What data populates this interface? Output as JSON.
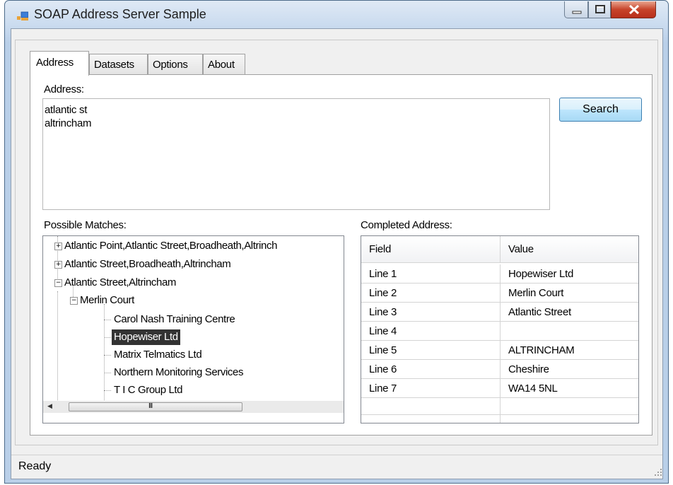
{
  "window": {
    "title": "SOAP Address Server Sample",
    "accent": "#c7432a"
  },
  "tabs": [
    {
      "label": "Address",
      "active": true
    },
    {
      "label": "Datasets",
      "active": false
    },
    {
      "label": "Options",
      "active": false
    },
    {
      "label": "About",
      "active": false
    }
  ],
  "address": {
    "label": "Address:",
    "lines": [
      "atlantic st",
      "altrincham"
    ],
    "search_label": "Search"
  },
  "matches": {
    "label": "Possible Matches:",
    "items": [
      {
        "text": "Atlantic Point,Atlantic Street,Broadheath,Altrinch",
        "expander": "+"
      },
      {
        "text": "Atlantic Street,Broadheath,Altrincham",
        "expander": "+"
      },
      {
        "text": "Atlantic Street,Altrincham",
        "expander": "−"
      },
      {
        "text": "Merlin Court",
        "expander": "−"
      },
      {
        "text": "Carol Nash Training Centre"
      },
      {
        "text": "Hopewiser Ltd",
        "selected": true
      },
      {
        "text": "Matrix Telmatics Ltd"
      },
      {
        "text": "Northern Monitoring Services"
      },
      {
        "text": "T I C Group Ltd"
      }
    ],
    "hscroll_glyph": "III"
  },
  "completed": {
    "label": "Completed Address:",
    "headers": {
      "field": "Field",
      "value": "Value"
    },
    "rows": [
      {
        "field": "Line 1",
        "value": "Hopewiser Ltd"
      },
      {
        "field": "Line 2",
        "value": "Merlin Court"
      },
      {
        "field": "Line 3",
        "value": "Atlantic Street"
      },
      {
        "field": "Line 4",
        "value": ""
      },
      {
        "field": "Line 5",
        "value": "ALTRINCHAM"
      },
      {
        "field": "Line 6",
        "value": "Cheshire"
      },
      {
        "field": "Line 7",
        "value": "WA14 5NL"
      }
    ]
  },
  "status": {
    "text": "Ready"
  }
}
